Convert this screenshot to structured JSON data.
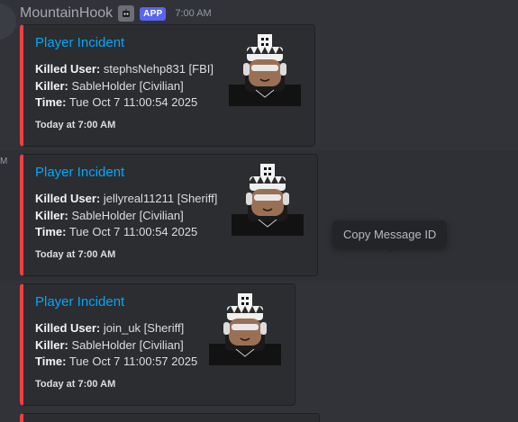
{
  "header": {
    "username": "MountainHook",
    "badge": "APP",
    "timestamp": "7:00 AM"
  },
  "side_time": "M",
  "embeds": [
    {
      "title": "Player Incident",
      "killed_user_label": "Killed User:",
      "killed_user": " stephsNehp831 [FBI]",
      "killer_label": "Killer:",
      "killer": " SableHolder [Civilian]",
      "time_label": "Time:",
      "time": " Tue Oct 7 11:00:54 2025",
      "footer": "Today at 7:00 AM"
    },
    {
      "title": "Player Incident",
      "killed_user_label": "Killed User:",
      "killed_user": " jellyreal11211 [Sheriff]",
      "killer_label": "Killer:",
      "killer": " SableHolder [Civilian]",
      "time_label": "Time:",
      "time": " Tue Oct 7 11:00:54 2025",
      "footer": "Today at 7:00 AM"
    },
    {
      "title": "Player Incident",
      "killed_user_label": "Killed User:",
      "killed_user": " join_uk [Sheriff]",
      "killer_label": "Killer:",
      "killer": " SableHolder [Civilian]",
      "time_label": "Time:",
      "time": " Tue Oct 7 11:00:57 2025",
      "footer": "Today at 7:00 AM"
    }
  ],
  "tooltip": "Copy Message ID",
  "colors": {
    "embed_accent": "#f23f43",
    "title_link": "#00a8fc",
    "app_badge": "#5865f2"
  }
}
